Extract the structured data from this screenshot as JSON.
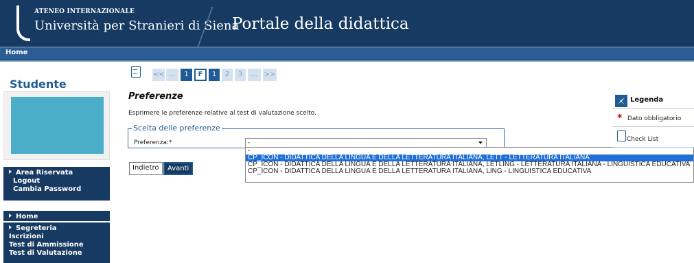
{
  "header": {
    "ateneo": "ATENEO INTERNAZIONALE",
    "university": "Università per Stranieri di Siena",
    "portal_title": "Portale della didattica"
  },
  "breadcrumb": {
    "home": "Home"
  },
  "sidebar": {
    "title": "Studente",
    "area_riservata": {
      "title": "Area Riservata",
      "items": [
        "Logout",
        "Cambia Password"
      ]
    },
    "home": "Home",
    "segreteria": {
      "title": "Segreteria",
      "items": [
        "Iscrizioni",
        "Test di Ammissione",
        "Test di Valutazione"
      ]
    }
  },
  "pager": {
    "prev": "<<",
    "ellipsis_left": "...",
    "first": "1",
    "current": "F",
    "page1": "1",
    "page2": "2",
    "page3": "3",
    "ellipsis_right": "...",
    "next": ">>"
  },
  "main": {
    "title": "Preferenze",
    "description": "Esprimere le preferenze relative al test di valutazione scelto.",
    "fieldset_legend": "Scelta delle preferenze",
    "field_label": "Preferenza:*",
    "select_value": "-",
    "options": [
      "-",
      "CP_ICON - DIDATTICA DELLA LINGUA E DELLA LETTERATURA ITALIANA, LETT - LETTERATURA ITALIANA",
      "CP_ICON - DIDATTICA DELLA LINGUA E DELLA LETTERATURA ITALIANA, LETLING - LETTERATURA ITALIANA - LINGUISTICA EDUCATIVA",
      "CP_ICON - DIDATTICA DELLA LINGUA E DELLA LETTERATURA ITALIANA, LING - LINGUISTICA EDUCATIVA"
    ],
    "highlighted_option_index": 1,
    "back_button": "Indietro",
    "next_button": "Avanti"
  },
  "legend": {
    "title": "Legenda",
    "required": "Dato obbligatorio",
    "checklist": "Check List"
  },
  "colors": {
    "header": "#173a62",
    "accent": "#1f5c96",
    "highlight": "#1e6fd8"
  }
}
